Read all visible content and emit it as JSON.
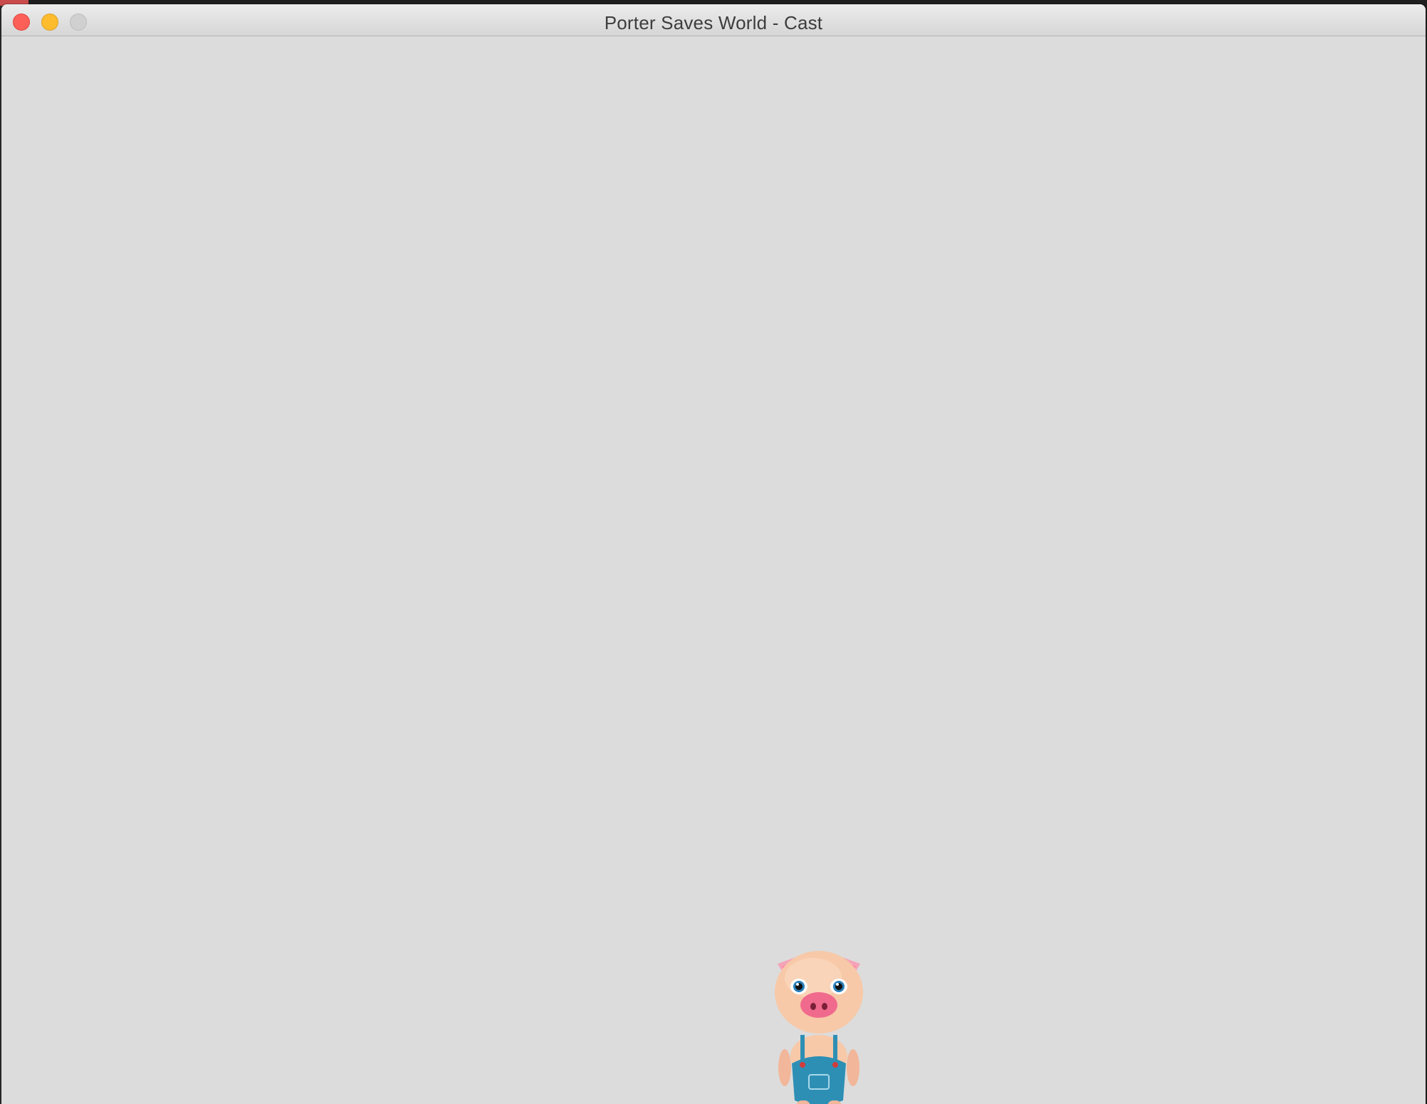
{
  "window": {
    "title": "Porter Saves World - Cast"
  },
  "titlebar": {
    "buttons": [
      {
        "name": "close",
        "color": "#fc5f57"
      },
      {
        "name": "minimize",
        "color": "#fdbc2e"
      },
      {
        "name": "zoom",
        "color": "#d0d0d0"
      }
    ]
  },
  "content": {
    "background": "#dcdcdc",
    "character": {
      "icon": "pig-character",
      "outfit_color": "#2e8fb5",
      "skin_color": "#f7c9a8",
      "snout_color": "#f06a8d"
    }
  }
}
